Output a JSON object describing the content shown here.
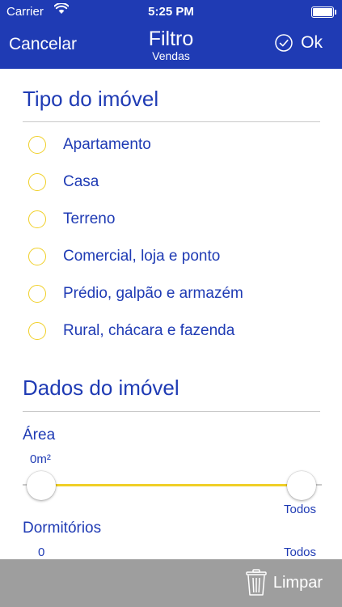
{
  "status_bar": {
    "carrier": "Carrier",
    "time": "5:25 PM"
  },
  "nav": {
    "cancel_label": "Cancelar",
    "title": "Filtro",
    "subtitle": "Vendas",
    "ok_label": "Ok"
  },
  "property_type": {
    "title": "Tipo do imóvel",
    "options": [
      {
        "label": "Apartamento",
        "selected": false
      },
      {
        "label": "Casa",
        "selected": false
      },
      {
        "label": "Terreno",
        "selected": false
      },
      {
        "label": "Comercial, loja e ponto",
        "selected": false
      },
      {
        "label": "Prédio, galpão e armazém",
        "selected": false
      },
      {
        "label": "Rural, chácara e fazenda",
        "selected": false
      }
    ]
  },
  "property_data": {
    "title": "Dados do imóvel",
    "area": {
      "label": "Área",
      "min_label": "0m²",
      "max_label": "Todos",
      "range_start": 0,
      "range_end": 1
    },
    "bedrooms": {
      "label": "Dormitórios",
      "min_label": "0",
      "max_label": "Todos"
    }
  },
  "bottom_bar": {
    "clear_label": "Limpar"
  },
  "colors": {
    "primary": "#1f3bb4",
    "accent": "#f0cf26",
    "divider": "#c9c9c9",
    "bottom_bar": "#9e9e9e"
  }
}
